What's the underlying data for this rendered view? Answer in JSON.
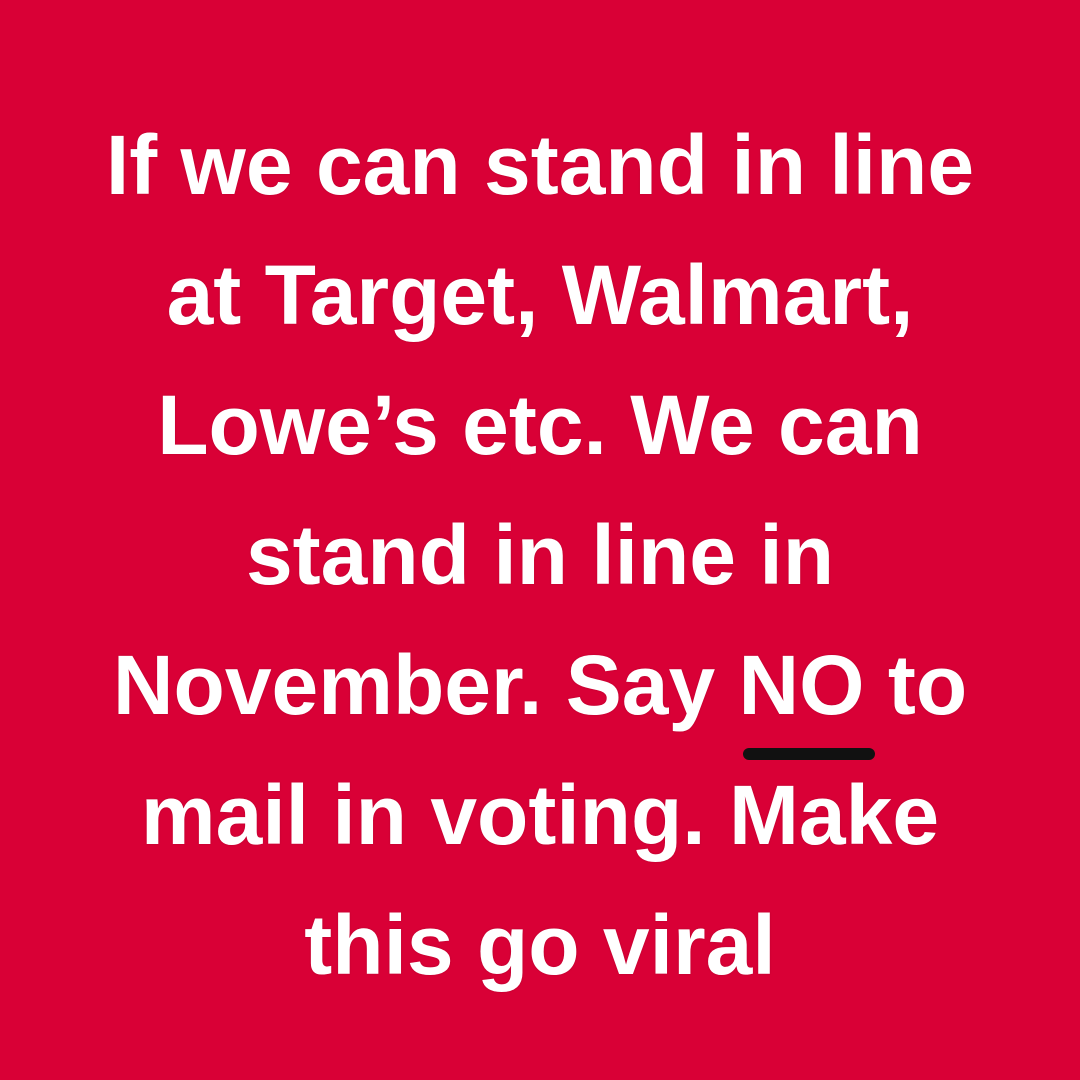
{
  "background_color": "#d90036",
  "text_color": "#ffffff",
  "underline_color": "#111111",
  "message": {
    "line1": "If we can stand in line",
    "line2": "at Target, Walmart,",
    "line3": "Lowe’s etc. We can",
    "line4": "stand in line in",
    "line5_before": "November. Say ",
    "line5_emphasis": "NO",
    "line5_after": " to",
    "line6": "mail in voting. Make",
    "line7": "this go viral"
  }
}
